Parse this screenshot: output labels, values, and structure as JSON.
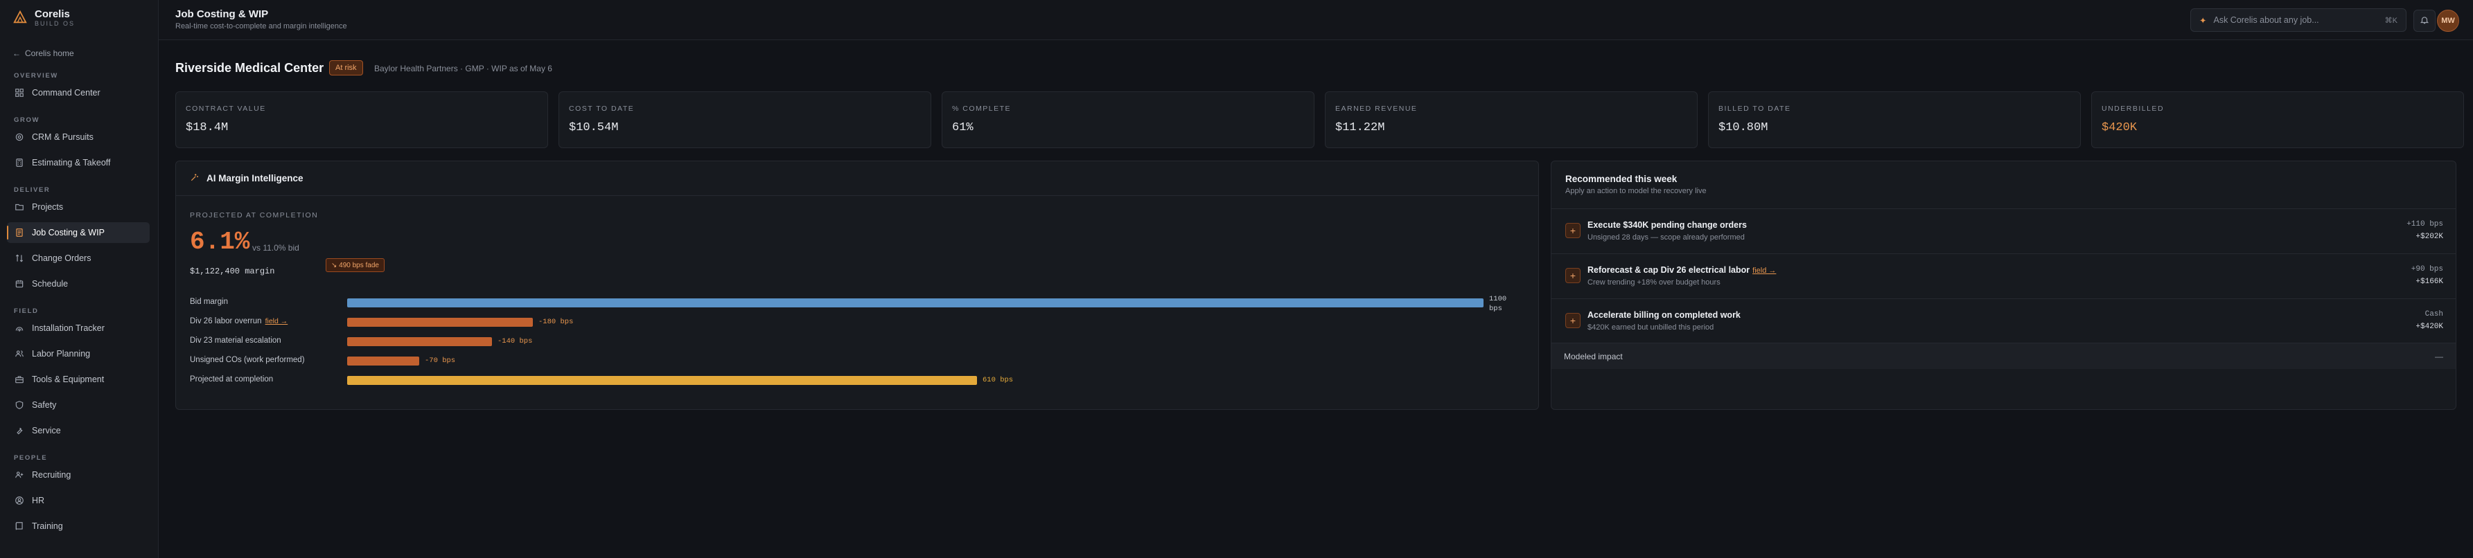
{
  "brand": {
    "name": "Corelis",
    "sub": "BUILD OS"
  },
  "sidebar": {
    "home": "Corelis home",
    "sections": [
      {
        "title": "OVERVIEW",
        "items": [
          {
            "label": "Command Center",
            "icon": "grid-icon"
          }
        ]
      },
      {
        "title": "GROW",
        "items": [
          {
            "label": "CRM & Pursuits",
            "icon": "target-icon"
          },
          {
            "label": "Estimating & Takeoff",
            "icon": "calculator-icon"
          }
        ]
      },
      {
        "title": "DELIVER",
        "items": [
          {
            "label": "Projects",
            "icon": "folder-icon"
          },
          {
            "label": "Job Costing & WIP",
            "icon": "receipt-icon",
            "active": true
          },
          {
            "label": "Change Orders",
            "icon": "swap-icon"
          },
          {
            "label": "Schedule",
            "icon": "calendar-icon"
          }
        ]
      },
      {
        "title": "FIELD",
        "items": [
          {
            "label": "Installation Tracker",
            "icon": "signal-icon"
          },
          {
            "label": "Labor Planning",
            "icon": "users-icon"
          },
          {
            "label": "Tools & Equipment",
            "icon": "toolbox-icon"
          },
          {
            "label": "Safety",
            "icon": "shield-icon"
          },
          {
            "label": "Service",
            "icon": "wrench-icon"
          }
        ]
      },
      {
        "title": "PEOPLE",
        "items": [
          {
            "label": "Recruiting",
            "icon": "user-plus-icon"
          },
          {
            "label": "HR",
            "icon": "circle-user-icon"
          },
          {
            "label": "Training",
            "icon": "book-icon"
          }
        ]
      }
    ]
  },
  "header": {
    "title": "Job Costing & WIP",
    "subtitle": "Real-time cost-to-complete and margin intelligence",
    "search_placeholder": "Ask Corelis about any job...",
    "shortcut": "⌘K",
    "avatar": "MW"
  },
  "project": {
    "name": "Riverside Medical Center",
    "badge": "At risk",
    "meta": "Baylor Health Partners · GMP · WIP as of May 6"
  },
  "kpis": [
    {
      "label": "CONTRACT VALUE",
      "value": "$18.4M"
    },
    {
      "label": "COST TO DATE",
      "value": "$10.54M"
    },
    {
      "label": "% COMPLETE",
      "value": "61%"
    },
    {
      "label": "EARNED REVENUE",
      "value": "$11.22M"
    },
    {
      "label": "BILLED TO DATE",
      "value": "$10.80M"
    },
    {
      "label": "UNDERBILLED",
      "value": "$420K",
      "warn": true
    }
  ],
  "margin": {
    "title": "AI Margin Intelligence",
    "projected_label": "PROJECTED AT COMPLETION",
    "pct": "6.1%",
    "vs": "vs 11.0% bid",
    "amount": "$1,122,400 margin",
    "fade": "↘ 490 bps fade",
    "bars": [
      {
        "label": "Bid margin",
        "link": "",
        "value": "1100 bps",
        "bps": 1100
      },
      {
        "label": "Div 26 labor overrun",
        "link": "field →",
        "value": "-180 bps",
        "bps": 180
      },
      {
        "label": "Div 23 material escalation",
        "link": "",
        "value": "-140 bps",
        "bps": 140
      },
      {
        "label": "Unsigned COs (work performed)",
        "link": "",
        "value": "-70 bps",
        "bps": 70
      },
      {
        "label": "Projected at completion",
        "link": "",
        "value": "610 bps",
        "bps": 610
      }
    ]
  },
  "recommendations": {
    "title": "Recommended this week",
    "subtitle": "Apply an action to model the recovery live",
    "items": [
      {
        "name": "Execute $340K pending change orders",
        "link": "",
        "desc": "Unsigned 28 days — scope already performed",
        "r1": "+110 bps",
        "r2": "+$202K"
      },
      {
        "name": "Reforecast & cap Div 26 electrical labor",
        "link": "field →",
        "desc": "Crew trending +18% over budget hours",
        "r1": "+90 bps",
        "r2": "+$166K"
      },
      {
        "name": "Accelerate billing on completed work",
        "link": "",
        "desc": "$420K earned but unbilled this period",
        "r1": "Cash",
        "r2": "+$420K"
      }
    ],
    "modeled_label": "Modeled impact",
    "modeled_value": "—"
  },
  "colors": {
    "accent": "#e8783e",
    "bid_bar": "#5b93c8",
    "neg_bar": "#c2612f",
    "proj_bar": "#e4a93a"
  }
}
